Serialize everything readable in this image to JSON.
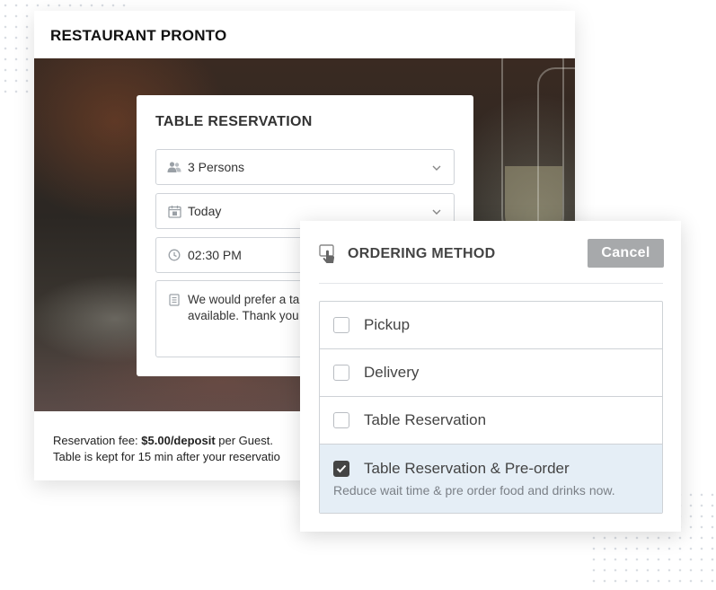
{
  "restaurant": {
    "name": "RESTAURANT PRONTO",
    "fee_prefix": "Reservation fee: ",
    "fee_amount": "$5.00/deposit",
    "fee_suffix": " per Guest.",
    "hold_note": "Table is kept for 15 min after your reservatio"
  },
  "reservation": {
    "title": "TABLE RESERVATION",
    "guests": {
      "value": "3 Persons",
      "icon": "users-icon"
    },
    "date": {
      "value": "Today",
      "icon": "calendar-icon"
    },
    "time": {
      "value": "02:30 PM",
      "icon": "clock-icon"
    },
    "note": {
      "value": "We would prefer a ta available. Thank you",
      "icon": "note-icon"
    }
  },
  "ordering": {
    "title": "ORDERING METHOD",
    "cancel_label": "Cancel",
    "options": [
      {
        "label": "Pickup",
        "checked": false
      },
      {
        "label": "Delivery",
        "checked": false
      },
      {
        "label": "Table Reservation",
        "checked": false
      },
      {
        "label": "Table Reservation & Pre-order",
        "checked": true,
        "description": "Reduce wait time & pre order food and drinks now."
      }
    ]
  },
  "colors": {
    "selected_background": "#e5eef6",
    "cancel_button": "#a7a9ab",
    "checkbox_checked": "#444444"
  }
}
